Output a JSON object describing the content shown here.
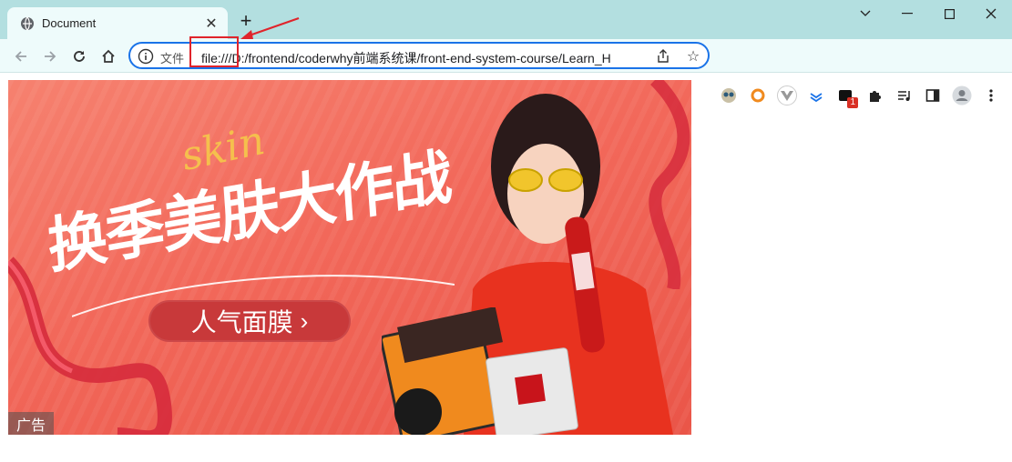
{
  "browser": {
    "tab": {
      "title": "Document",
      "close_glyph": "✕"
    },
    "new_tab_glyph": "+",
    "window_controls": {
      "minimize": "—",
      "maximize": "☐",
      "close": "✕",
      "menu": "⌄"
    },
    "address_bar": {
      "scheme_label": "文件",
      "url": "file:///D:/frontend/coderwhy前端系统课/front-end-system-course/Learn_H"
    },
    "extensions": [
      "owl-extension-icon",
      "orange-extension-icon",
      "vue-devtools-icon",
      "stack-extension-icon",
      "badge-extension-icon",
      "puzzle-icon",
      "media-icon",
      "sidepanel-icon",
      "profile-icon",
      "menu-icon"
    ],
    "extension_badge": "1"
  },
  "ad": {
    "headline": "换季美肤大作战",
    "script_word": "skin",
    "cta_label": "人气面膜",
    "cta_chevron": "›",
    "tag": "广告"
  },
  "colors": {
    "titlebar": "#b3dfe0",
    "toolbar": "#eefbfb",
    "accent": "#1a73e8",
    "highlight": "#e0242b",
    "ad_bg": "#f2685a"
  }
}
